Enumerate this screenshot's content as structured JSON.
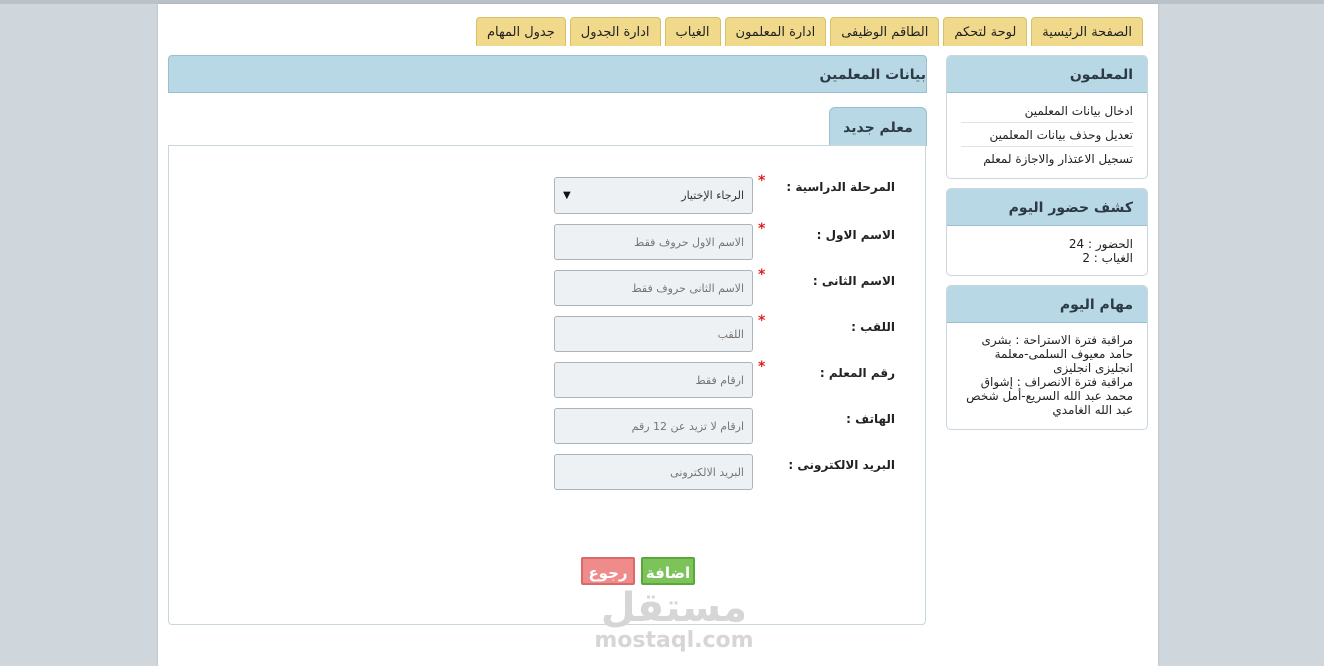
{
  "tabs": [
    "الصفحة الرئيسية",
    "لوحة لتحكم",
    "الطاقم الوظيفى",
    "ادارة المعلمون",
    "الغياب",
    "ادارة الجدول",
    "جدول المهام"
  ],
  "sidebar": {
    "teachers": {
      "title": "المعلمون",
      "links": [
        "ادخال بيانات المعلمين",
        "تعديل وحذف بيانات المعلمين",
        "تسجيل الاعتذار والاجازة لمعلم"
      ]
    },
    "attendance": {
      "title": "كشف حضور اليوم",
      "present": "الحضور : 24",
      "absent": "الغياب : 2"
    },
    "tasks": {
      "title": "مهام اليوم",
      "lines": [
        "مراقبة فترة الاستراحة : بشرى",
        "حامد معيوف السلمى-معلمة",
        "انجليزى انجليزى",
        "مراقبة فترة الانصراف : إشواق",
        "محمد عبد الله السريع-أمل شخص",
        "عبد الله الغامدي"
      ]
    }
  },
  "main": {
    "header": "بيانات المعلمين",
    "subtab": "معلم جديد",
    "form": {
      "stage_label": "المرحلة الدراسية :",
      "stage_value": "الرجاء الإختيار",
      "first_name_label": "الاسم الاول :",
      "first_name_placeholder": "الاسم الاول حروف فقط",
      "second_name_label": "الاسم الثانى :",
      "second_name_placeholder": "الاسم الثانى حروف فقط",
      "surname_label": "اللقب :",
      "surname_placeholder": "اللقب",
      "teacher_no_label": "رقم المعلم :",
      "teacher_no_placeholder": "ارقام فقط",
      "phone_label": "الهاتف :",
      "phone_placeholder": "ارقام لا تزيد عن 12 رقم",
      "email_label": "البريد الالكترونى :",
      "email_placeholder": "البريد الالكترونى",
      "required_mark": "*",
      "add_button": "اضافة",
      "back_button": "رجوع"
    }
  },
  "watermark": {
    "arabic": "مستقل",
    "latin": "mostaql.com"
  }
}
